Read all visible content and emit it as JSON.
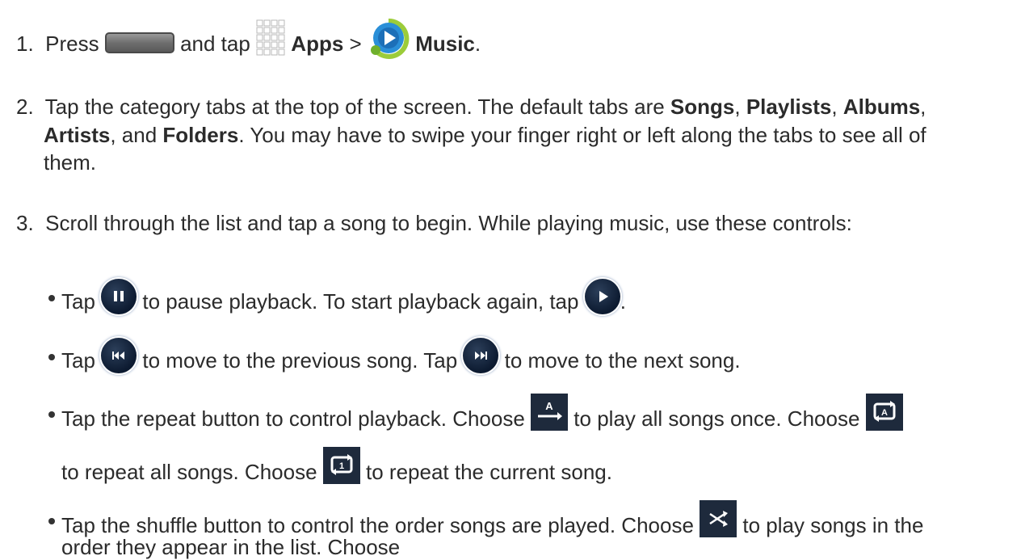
{
  "steps": {
    "s1": {
      "num": "1.",
      "press": "Press",
      "and_tap": "and tap",
      "apps": "Apps",
      "sep": ">",
      "music": "Music",
      "end": "."
    },
    "s2": {
      "num": "2.",
      "a": "Tap the category tabs at the top of the screen. The default tabs are",
      "songs": "Songs",
      "c1": ",",
      "playlists": "Playlists",
      "c2": ",",
      "albums": "Albums",
      "c3": ",",
      "artists": "Artists",
      "and": ", and",
      "folders": "Folders",
      "b": ". You may have to swipe your finger right or left along the tabs to see all of",
      "c": "them."
    },
    "s3": {
      "num": "3.",
      "text": "Scroll through the list and tap a song to begin. While playing music, use these controls:"
    }
  },
  "bullets": {
    "b1": {
      "tap": "Tap",
      "mid": "to pause playback. To start playback again, tap",
      "end": "."
    },
    "b2": {
      "tap": "Tap",
      "mid": "to move to the previous song. Tap",
      "end": "to move to the next song."
    },
    "b3": {
      "a": "Tap the repeat button to control playback. Choose",
      "b": "to play all songs once. Choose",
      "c": "to repeat all songs. Choose",
      "d": "to repeat the current song."
    },
    "b4": {
      "a": "Tap the shuffle button to control the order songs are played. Choose",
      "b": "to play songs in the",
      "c": "order they appear in the list. Choose"
    }
  },
  "icons": {
    "home_key": "home-key-icon",
    "apps": "apps-grid-icon",
    "music": "music-app-icon",
    "pause": "pause-icon",
    "play": "play-icon",
    "previous": "previous-icon",
    "next": "next-icon",
    "repeat_off": "repeat-off-icon",
    "repeat_all": "repeat-all-icon",
    "repeat_one": "repeat-one-icon",
    "shuffle_off": "shuffle-off-icon"
  },
  "colors": {
    "text": "#2b2b2b",
    "button_dark": "#1e2a3c",
    "music_blue": "#2a8fd8"
  }
}
